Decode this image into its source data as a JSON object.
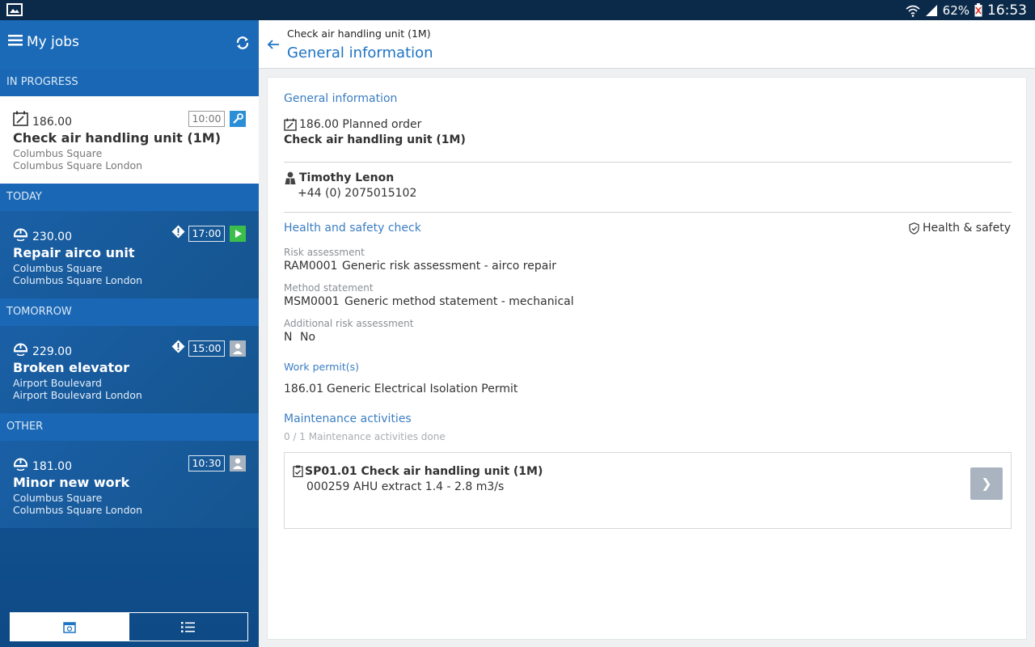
{
  "status_bar": {
    "battery": "62%",
    "time": "16:53"
  },
  "sidebar": {
    "title": "My jobs",
    "sections": {
      "in_progress": "IN PROGRESS",
      "today": "TODAY",
      "tomorrow": "TOMORROW",
      "other": "OTHER"
    },
    "jobs": [
      {
        "number": "186.00",
        "title": "Check air handling unit (1M)",
        "addr1": "Columbus Square",
        "addr2": "Columbus Square London",
        "time": "10:00",
        "icon": "calendar-edit-icon",
        "status": "wrench-icon"
      },
      {
        "number": "230.00",
        "title": "Repair airco unit",
        "addr1": "Columbus Square",
        "addr2": "Columbus Square London",
        "time": "17:00",
        "icon": "hard-hat-icon",
        "status": "play-icon",
        "warning": true
      },
      {
        "number": "229.00",
        "title": "Broken elevator",
        "addr1": "Airport Boulevard",
        "addr2": "Airport Boulevard London",
        "time": "15:00",
        "icon": "hard-hat-icon",
        "status": "person-icon",
        "warning": true
      },
      {
        "number": "181.00",
        "title": "Minor new work",
        "addr1": "Columbus Square",
        "addr2": "Columbus Square London",
        "time": "10:30",
        "icon": "hard-hat-icon",
        "status": "person-icon"
      }
    ]
  },
  "topbar": {
    "breadcrumb": "Check air handling unit (1M)",
    "title": "General information"
  },
  "detail": {
    "general_title": "General information",
    "order_line": "186.00 Planned order",
    "order_title": "Check air handling unit (1M)",
    "contact_name": "Timothy Lenon",
    "contact_phone": "+44 (0) 2075015102",
    "hs_title": "Health and safety check",
    "hs_button": "Health & safety",
    "risk_label": "Risk assessment",
    "risk_code": "RAM0001",
    "risk_value": "Generic risk assessment - airco repair",
    "method_label": "Method statement",
    "method_code": "MSM0001",
    "method_value": "Generic method statement - mechanical",
    "additional_label": "Additional risk assessment",
    "additional_code": "N",
    "additional_value": "No",
    "permits_label": "Work permit(s)",
    "permit_code": "186.01",
    "permit_value": "Generic Electrical Isolation Permit",
    "maint_title": "Maintenance activities",
    "maint_progress": "0 / 1 Maintenance activities done",
    "activity_title": "SP01.01 Check air handling unit (1M)",
    "activity_sub": "000259 AHU extract 1.4 - 2.8 m3/s"
  },
  "colors": {
    "accent": "#1e73c4",
    "sidebar": "#1a66b3",
    "play": "#3cbf4a"
  }
}
